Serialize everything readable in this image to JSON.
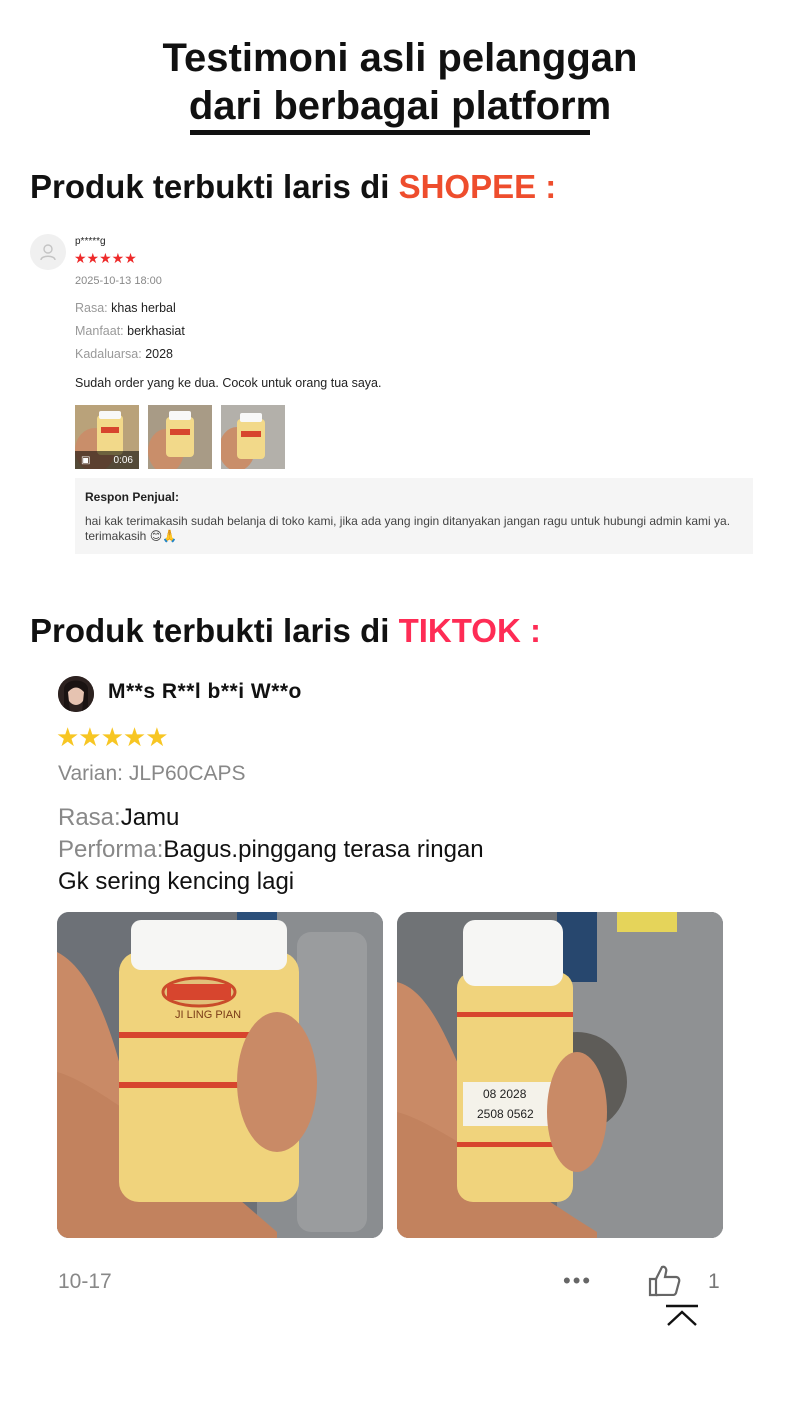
{
  "headline": {
    "line1": "Testimoni asli pelanggan",
    "line2": "dari berbagai platform"
  },
  "shopee_section": {
    "title_prefix": "Produk terbukti laris di ",
    "brand": "SHOPEE",
    "suffix": " :",
    "review": {
      "username": "p*****g",
      "stars": "★★★★★",
      "date": "2025-10-13 18:00",
      "attributes": [
        {
          "key": "Rasa: ",
          "value": "khas herbal"
        },
        {
          "key": "Manfaat: ",
          "value": "berkhasiat"
        },
        {
          "key": "Kadaluarsa: ",
          "value": "2028"
        }
      ],
      "comment": "Sudah order yang ke dua. Cocok untuk orang tua saya.",
      "video_duration": "0:06",
      "reply_title": "Respon Penjual:",
      "reply_text": "hai kak terimakasih sudah belanja di toko kami, jika ada yang ingin ditanyakan jangan ragu untuk hubungi admin kami ya. terimakasih 😊🙏"
    }
  },
  "tiktok_section": {
    "title_prefix": "Produk terbukti laris di ",
    "brand": "TIKTOK",
    "suffix": " :",
    "review": {
      "username": "M**s R**l b**i W**o",
      "stars": "★★★★★",
      "variant": "Varian: JLP60CAPS",
      "rasa_key": "Rasa:",
      "rasa_value": "Jamu",
      "performa_key": "Performa:",
      "performa_value": "Bagus.pinggang terasa ringan",
      "extra_line": "Gk sering kencing lagi",
      "date": "10-17",
      "more": "•••",
      "like_count": "1",
      "photo1_label": "JI LING PIAN",
      "photo2_label1": "08 2028",
      "photo2_label2": "2508 0562"
    }
  },
  "colors": {
    "shopee": "#ee4d2d",
    "tiktok": "#fe2c55",
    "star_shopee": "#ee2a2a",
    "star_tiktok": "#f7c623"
  }
}
